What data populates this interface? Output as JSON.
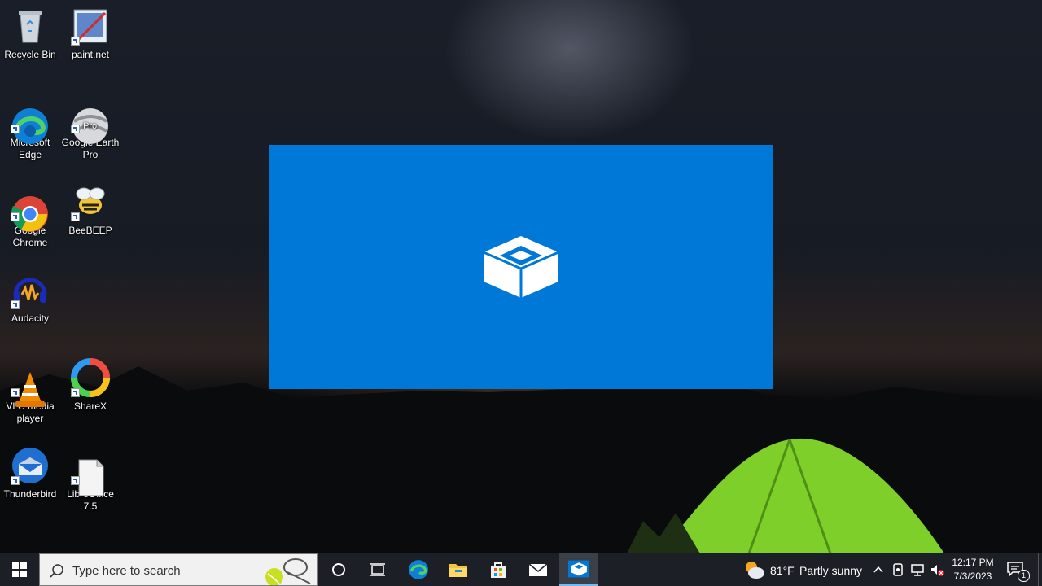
{
  "desktop": {
    "icons": [
      {
        "label": "Recycle Bin",
        "icon": "recycle-bin-icon"
      },
      {
        "label": "paint.net",
        "icon": "paintnet-icon"
      },
      {
        "label": "Microsoft\nEdge",
        "icon": "edge-icon"
      },
      {
        "label": "Google Earth\nPro",
        "icon": "google-earth-icon",
        "badge": "Pro"
      },
      {
        "label": "Google\nChrome",
        "icon": "chrome-icon"
      },
      {
        "label": "BeeBEEP",
        "icon": "beebeep-icon"
      },
      {
        "label": "Audacity",
        "icon": "audacity-icon"
      },
      {
        "label": "VLC media\nplayer",
        "icon": "vlc-icon"
      },
      {
        "label": "ShareX",
        "icon": "sharex-icon"
      },
      {
        "label": "Thunderbird",
        "icon": "thunderbird-icon"
      },
      {
        "label": "LibreOffice\n7.5",
        "icon": "libreoffice-icon"
      }
    ]
  },
  "splash": {
    "app_icon": "windows-sandbox-icon",
    "color": "#0078d7"
  },
  "taskbar": {
    "search_placeholder": "Type here to search",
    "pinned": [
      "cortana-icon",
      "task-view-icon",
      "edge-icon",
      "file-explorer-icon",
      "store-icon",
      "mail-icon",
      "windows-sandbox-icon"
    ],
    "weather": {
      "temp": "81°F",
      "condition": "Partly sunny"
    },
    "clock": {
      "time": "12:17 PM",
      "date": "7/3/2023"
    },
    "notification_count": "1"
  }
}
